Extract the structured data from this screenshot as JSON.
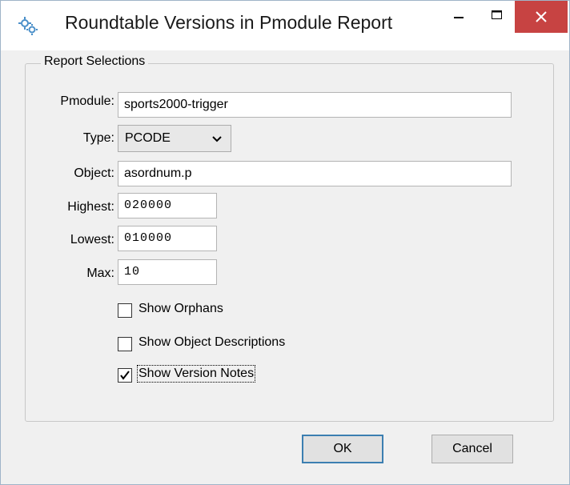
{
  "window": {
    "title": "Roundtable Versions in Pmodule Report",
    "icon": "roundtable-gear-icon",
    "controls": {
      "minimize": "–",
      "maximize": "☐",
      "close": "✕"
    },
    "colors": {
      "close_hover": "#c74342",
      "accent": "#3c7fb1"
    }
  },
  "form": {
    "group_title": "Report Selections",
    "pmodule": {
      "label": "Pmodule:",
      "value": "sports2000-trigger"
    },
    "type": {
      "label": "Type:",
      "value": "PCODE"
    },
    "object": {
      "label": "Object:",
      "value": "asordnum.p"
    },
    "highest": {
      "label": "Highest:",
      "value": "020000"
    },
    "lowest": {
      "label": "Lowest:",
      "value": "010000"
    },
    "max": {
      "label": "Max:",
      "value": "10"
    },
    "checkboxes": [
      {
        "label": "Show Orphans",
        "checked": false
      },
      {
        "label": "Show Object Descriptions",
        "checked": false
      },
      {
        "label": "Show Version Notes",
        "checked": true
      }
    ]
  },
  "buttons": {
    "ok": "OK",
    "cancel": "Cancel"
  }
}
